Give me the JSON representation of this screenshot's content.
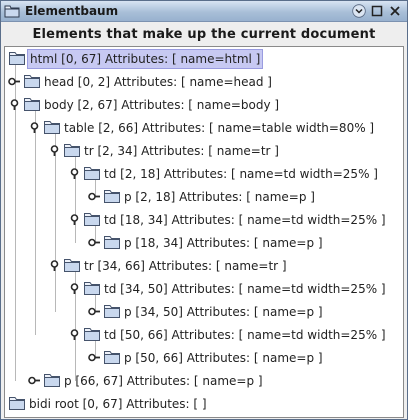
{
  "window": {
    "title": "Elementbaum",
    "heading": "Elements that make up the current document"
  },
  "colors": {
    "selection": "#c7c9f2",
    "titlebar": "#a9bfd8",
    "folder_fill": "#c9d8ee",
    "folder_stroke": "#45536b"
  },
  "tree": {
    "nodes": [
      {
        "label": "html [0, 67] Attributes: [ name=html ]",
        "selected": true,
        "handle": "none"
      },
      {
        "label": "head [0, 2] Attributes: [ name=head ]",
        "handle": "collapsed"
      },
      {
        "label": "body [2, 67] Attributes: [ name=body ]",
        "handle": "expanded"
      },
      {
        "label": "table [2, 66] Attributes: [ name=table width=80% ]",
        "handle": "expanded"
      },
      {
        "label": "tr [2, 34] Attributes: [ name=tr ]",
        "handle": "expanded"
      },
      {
        "label": "td [2, 18] Attributes: [ name=td width=25% ]",
        "handle": "expanded"
      },
      {
        "label": "p [2, 18] Attributes: [ name=p ]",
        "handle": "collapsed"
      },
      {
        "label": "td [18, 34] Attributes: [ name=td width=25% ]",
        "handle": "expanded"
      },
      {
        "label": "p [18, 34] Attributes: [ name=p ]",
        "handle": "collapsed"
      },
      {
        "label": "tr [34, 66] Attributes: [ name=tr ]",
        "handle": "expanded"
      },
      {
        "label": "td [34, 50] Attributes: [ name=td width=25% ]",
        "handle": "expanded"
      },
      {
        "label": "p [34, 50] Attributes: [ name=p ]",
        "handle": "collapsed"
      },
      {
        "label": "td [50, 66] Attributes: [ name=td width=25% ]",
        "handle": "expanded"
      },
      {
        "label": "p [50, 66] Attributes: [ name=p ]",
        "handle": "collapsed"
      },
      {
        "label": "p [66, 67] Attributes: [ name=p ]",
        "handle": "collapsed"
      },
      {
        "label": "bidi root [0, 67] Attributes: [ ]",
        "handle": "none"
      }
    ]
  }
}
